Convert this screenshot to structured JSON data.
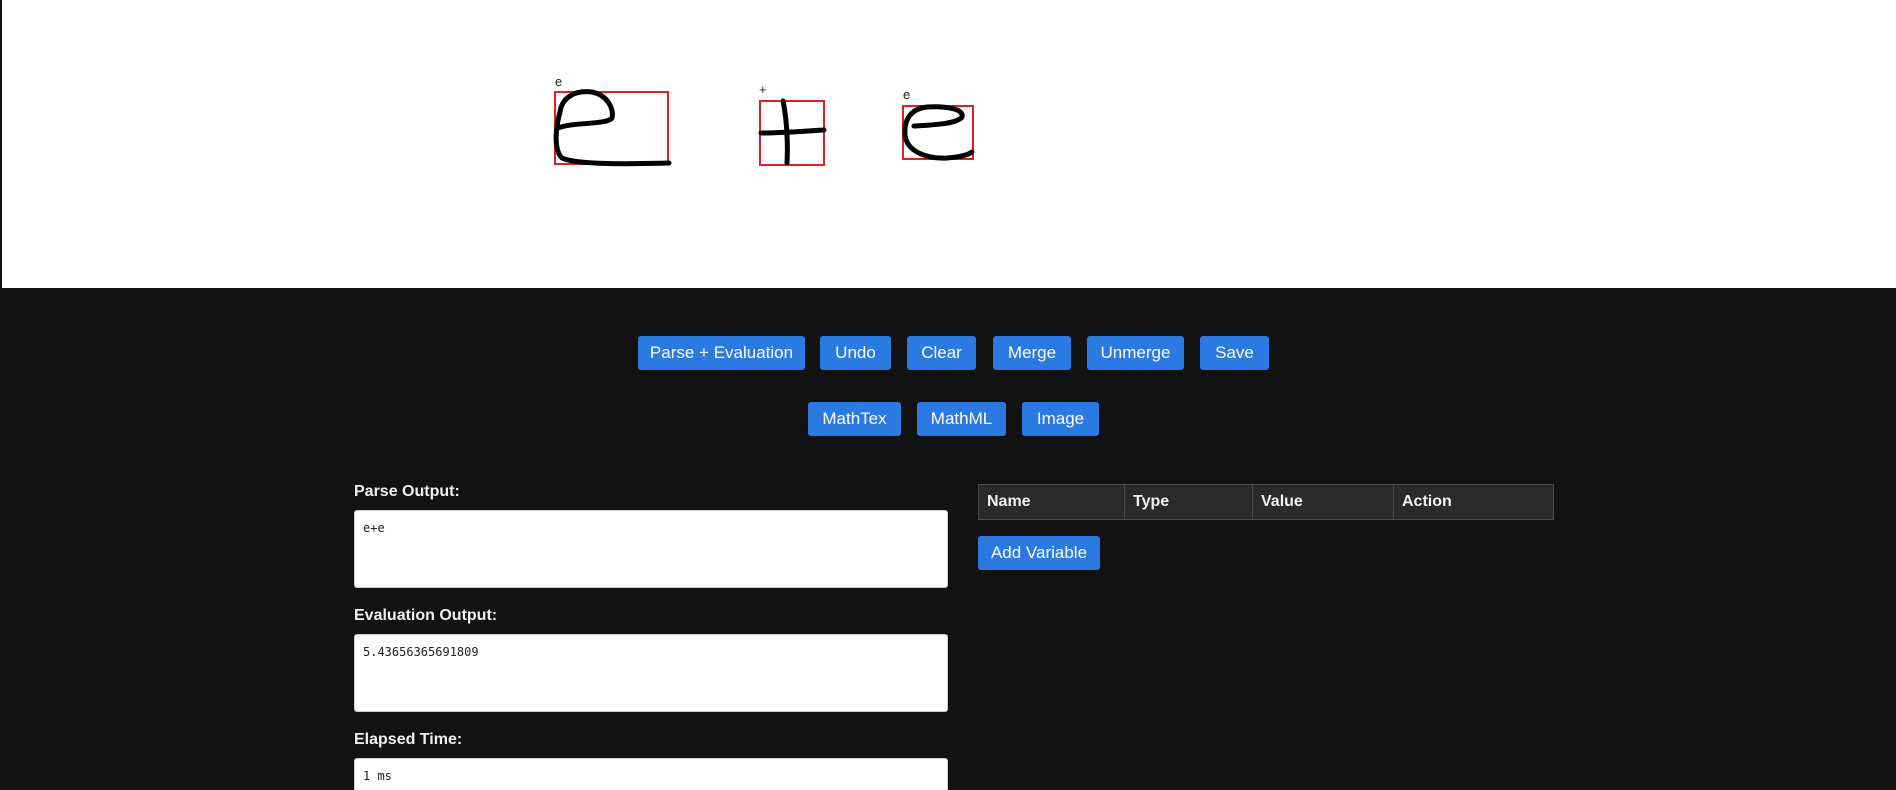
{
  "canvas": {
    "symbols": [
      {
        "label": "e",
        "color": "#e02020"
      },
      {
        "label": "+",
        "color": "#e02020"
      },
      {
        "label": "e",
        "color": "#e02020"
      }
    ]
  },
  "toolbar_primary": [
    {
      "label": "Parse + Evaluation"
    },
    {
      "label": "Undo"
    },
    {
      "label": "Clear"
    },
    {
      "label": "Merge"
    },
    {
      "label": "Unmerge"
    },
    {
      "label": "Save"
    }
  ],
  "toolbar_secondary": [
    {
      "label": "MathTex"
    },
    {
      "label": "MathML"
    },
    {
      "label": "Image"
    }
  ],
  "outputs": {
    "parse": {
      "label": "Parse Output:",
      "value": "e+e"
    },
    "evaluation": {
      "label": "Evaluation Output:",
      "value": "5.43656365691809"
    },
    "elapsed": {
      "label": "Elapsed Time:",
      "value": "1 ms"
    }
  },
  "variables": {
    "columns": [
      "Name",
      "Type",
      "Value",
      "Action"
    ],
    "add_label": "Add Variable"
  },
  "colors": {
    "accent": "#2a7ae2",
    "background": "#121212",
    "bounding_box": "#e02020"
  }
}
